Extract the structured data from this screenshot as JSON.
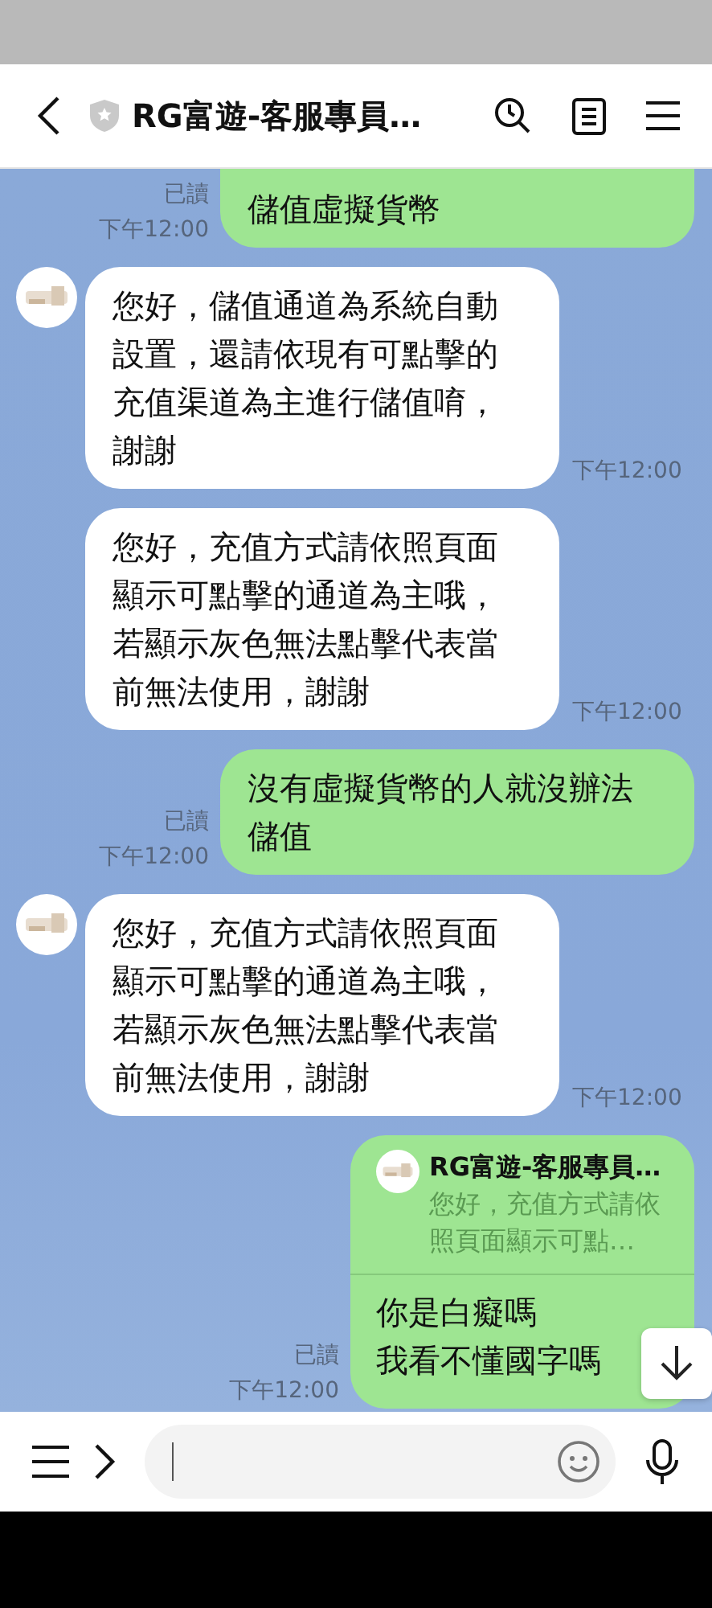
{
  "header": {
    "title": "RG富遊-客服專員…"
  },
  "messages": [
    {
      "kind": "outgoing",
      "text": "儲值虛擬貨幣",
      "read": "已讀",
      "time": "下午12:00"
    },
    {
      "kind": "incoming",
      "show_avatar": true,
      "text": "您好，儲值通道為系統自動設置，還請依現有可點擊的充值渠道為主進行儲值唷，謝謝",
      "time": "下午12:00"
    },
    {
      "kind": "incoming",
      "show_avatar": false,
      "text": "您好，充值方式請依照頁面顯示可點擊的通道為主哦，若顯示灰色無法點擊代表當前無法使用，謝謝",
      "time": "下午12:00"
    },
    {
      "kind": "outgoing",
      "text": "沒有虛擬貨幣的人就沒辦法儲值",
      "read": "已讀",
      "time": "下午12:00"
    },
    {
      "kind": "incoming",
      "show_avatar": true,
      "text": "您好，充值方式請依照頁面顯示可點擊的通道為主哦，若顯示灰色無法點擊代表當前無法使用，謝謝",
      "time": "下午12:00"
    },
    {
      "kind": "reply",
      "quote_name": "RG富遊-客服專員…",
      "quote_text": "您好，充值方式請依照頁面顯示可點…",
      "lines": [
        "你是白癡嗎",
        "我看不懂國字嗎"
      ],
      "read": "已讀",
      "time": "下午12:00"
    }
  ]
}
